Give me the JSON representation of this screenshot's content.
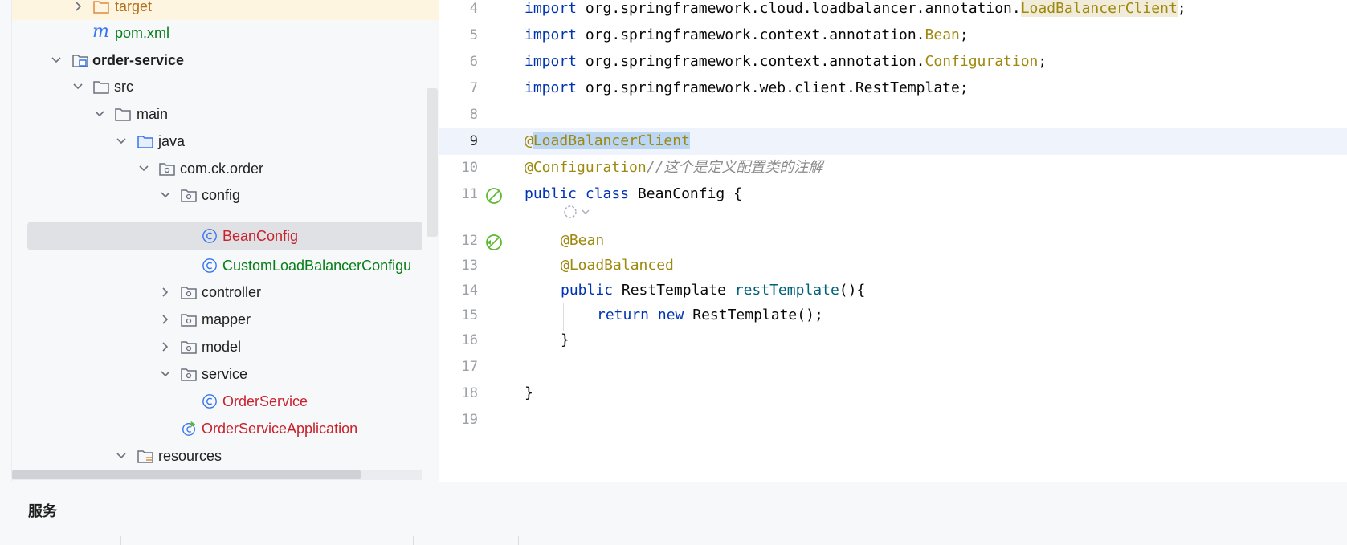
{
  "project_tree": {
    "rows": [
      {
        "label": "target",
        "color": "orange"
      },
      {
        "label": "pom.xml",
        "color": "green"
      },
      {
        "label": "order-service",
        "color": "bold"
      },
      {
        "label": "src",
        "color": "default"
      },
      {
        "label": "main",
        "color": "default"
      },
      {
        "label": "java",
        "color": "default"
      },
      {
        "label": "com.ck.order",
        "color": "default"
      },
      {
        "label": "config",
        "color": "default"
      },
      {
        "label": "BeanConfig",
        "color": "red",
        "selected": true
      },
      {
        "label": "CustomLoadBalancerConfigu",
        "color": "green"
      },
      {
        "label": "controller",
        "color": "default"
      },
      {
        "label": "mapper",
        "color": "default"
      },
      {
        "label": "model",
        "color": "default"
      },
      {
        "label": "service",
        "color": "default"
      },
      {
        "label": "OrderService",
        "color": "red"
      },
      {
        "label": "OrderServiceApplication",
        "color": "red"
      },
      {
        "label": "resources",
        "color": "default"
      }
    ]
  },
  "editor": {
    "line_numbers": [
      "4",
      "5",
      "6",
      "7",
      "8",
      "9",
      "10",
      "11",
      "12",
      "13",
      "14",
      "15",
      "16",
      "17",
      "18",
      "19"
    ],
    "current_line": "9",
    "code": {
      "l4": {
        "kw": "import",
        "pkg": " org.springframework.cloud.loadbalancer.annotation.",
        "cls": "LoadBalancerClient",
        "end": ";"
      },
      "l5": {
        "kw": "import",
        "pkg": " org.springframework.context.annotation.",
        "cls": "Bean",
        "end": ";"
      },
      "l6": {
        "kw": "import",
        "pkg": " org.springframework.context.annotation.",
        "cls": "Configuration",
        "end": ";"
      },
      "l7": {
        "kw": "import",
        "rest": " org.springframework.web.client.RestTemplate;"
      },
      "l9": {
        "at": "@",
        "name": "LoadBalancerClient"
      },
      "l10": {
        "ann": "@Configuration",
        "comment": "//这个是定义配置类的注解"
      },
      "l11": {
        "kw1": "public",
        "kw2": " class",
        "rest": " BeanConfig {"
      },
      "l12": {
        "ann": "@Bean"
      },
      "l13": {
        "ann": "@LoadBalanced"
      },
      "l14": {
        "kw": "public",
        "type": " RestTemplate ",
        "fn": "restTemplate",
        "end": "(){"
      },
      "l15": {
        "kw1": "return",
        "kw2": " new",
        "rest": " RestTemplate();"
      },
      "l16": {
        "text": "}"
      },
      "l18": {
        "text": "}"
      }
    }
  },
  "services_panel": {
    "title": "服务"
  },
  "colors": {
    "keyword": "#0033b3",
    "annotation": "#9e880d",
    "comment": "#8c8c8c",
    "selection": "#bcd6f5",
    "modified_file": "#c7222d",
    "added_file": "#067d17"
  }
}
